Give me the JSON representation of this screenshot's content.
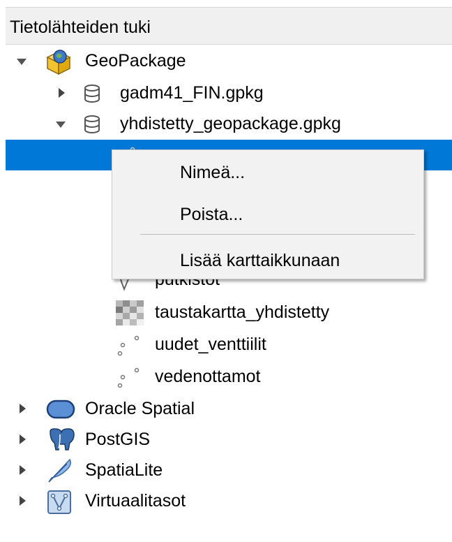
{
  "panel": {
    "title": "Tietolähteiden tuki"
  },
  "tree": {
    "geopackage": {
      "label": "GeoPackage",
      "children": [
        {
          "label": "gadm41_FIN.gpkg"
        },
        {
          "label": "yhdistetty_geopackage.gpkg",
          "layers": [
            {
              "label": "putkistot"
            },
            {
              "label": "taustakartta_yhdistetty"
            },
            {
              "label": "uudet_venttiilit"
            },
            {
              "label": "vedenottamot"
            }
          ]
        }
      ]
    },
    "providers": [
      {
        "label": "Oracle Spatial"
      },
      {
        "label": "PostGIS"
      },
      {
        "label": "SpatiaLite"
      },
      {
        "label": "Virtuaalitasot"
      }
    ]
  },
  "context_menu": {
    "rename": "Nimeä...",
    "delete": "Poista...",
    "add_to_map": "Lisää karttaikkunaan"
  },
  "colors": {
    "selection": "#0078d7",
    "menu_bg": "#f2f2f2"
  }
}
